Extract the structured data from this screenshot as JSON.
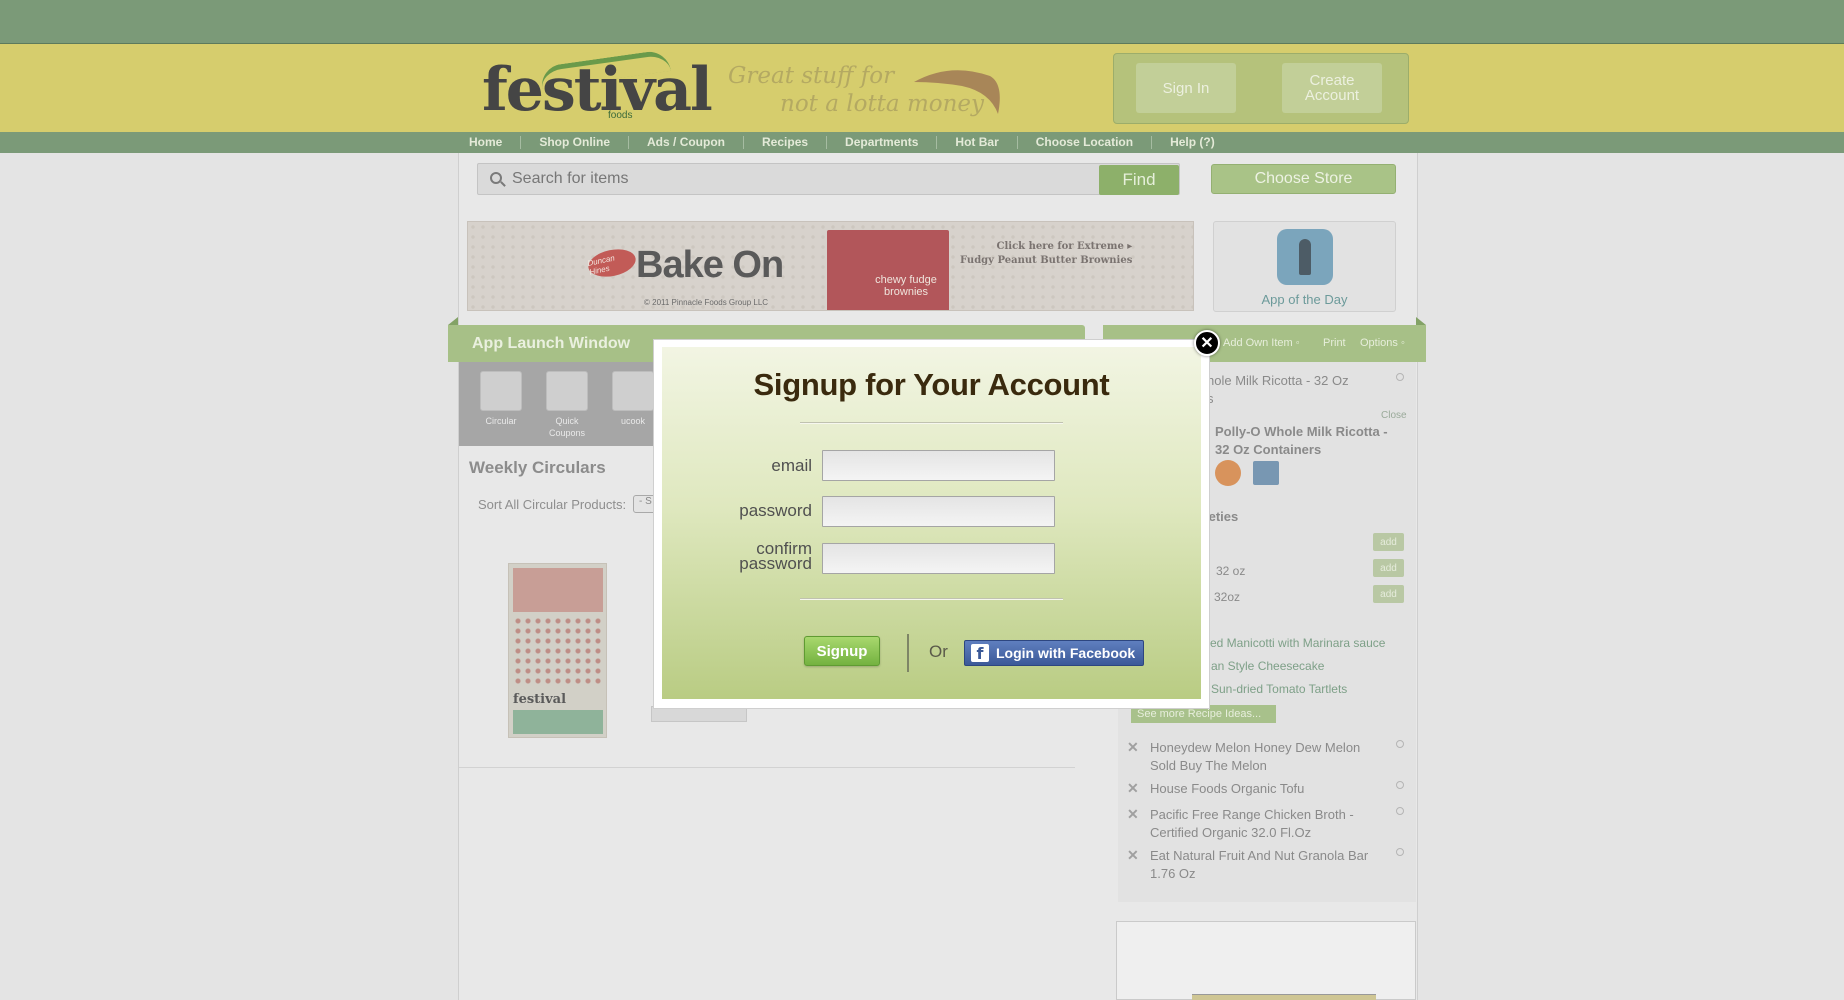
{
  "header": {
    "logo_text": "festival",
    "logo_sub": "foods",
    "tagline_line1": "Great stuff for",
    "tagline_line2": "not a lotta money",
    "sign_in_label": "Sign In",
    "create_account_label": "Create Account"
  },
  "nav": {
    "items": [
      "Home",
      "Shop Online",
      "Ads / Coupon",
      "Recipes",
      "Departments",
      "Hot Bar",
      "Choose Location",
      "Help (?)"
    ]
  },
  "search": {
    "placeholder": "Search for items",
    "find_label": "Find",
    "choose_store_label": "Choose Store"
  },
  "banner": {
    "title": "Bake On",
    "copyright": "© 2011 Pinnacle Foods Group LLC",
    "product": "chewy fudge brownies",
    "cta_line1": "Click here for Extreme",
    "cta_line2": "Fudgy Peanut Butter Brownies",
    "brand": "Duncan Hines"
  },
  "app_of_day": {
    "label": "App of the Day"
  },
  "app_launch": {
    "title": "App Launch Window",
    "tiles": [
      {
        "label": "Circular"
      },
      {
        "label": "Quick Coupons"
      },
      {
        "label": "ucook"
      }
    ]
  },
  "weekly": {
    "title": "Weekly Circulars",
    "sort_label": "Sort All Circular Products:",
    "sort_value": "- S",
    "thumb_logo": "festival"
  },
  "right_col": {
    "links": [
      "Add Own Item",
      "Print",
      "Options"
    ],
    "item1": "hole Milk Ricotta - 32 Oz",
    "item1b": "s",
    "close_label": "Close",
    "detail_title_l1": "Polly-O Whole Milk Ricotta -",
    "detail_title_l2": "32 Oz Containers",
    "varieties_label": "ieties",
    "variety_rows": [
      "",
      "32 oz",
      "32oz"
    ],
    "add_label": "add",
    "recipes": [
      "ed Manicotti with Marinara sauce",
      "an Style Cheesecake",
      "Sun-dried Tomato Tartlets"
    ],
    "see_more": "See more Recipe Ideas...",
    "list": [
      {
        "l1": "Honeydew Melon Honey Dew Melon",
        "l2": "Sold Buy The Melon"
      },
      {
        "l1": "House Foods Organic Tofu",
        "l2": ""
      },
      {
        "l1": "Pacific Free Range Chicken Broth -",
        "l2": "Certified Organic 32.0 Fl.Oz"
      },
      {
        "l1": "Eat Natural Fruit And Nut Granola Bar",
        "l2": "1.76 Oz"
      }
    ]
  },
  "modal": {
    "title": "Signup for Your Account",
    "email_label": "email",
    "password_label": "password",
    "confirm_label_l1": "confirm",
    "confirm_label_l2": "password",
    "signup_label": "Signup",
    "or_label": "Or",
    "facebook_label": "Login with Facebook",
    "close_glyph": "✕"
  }
}
